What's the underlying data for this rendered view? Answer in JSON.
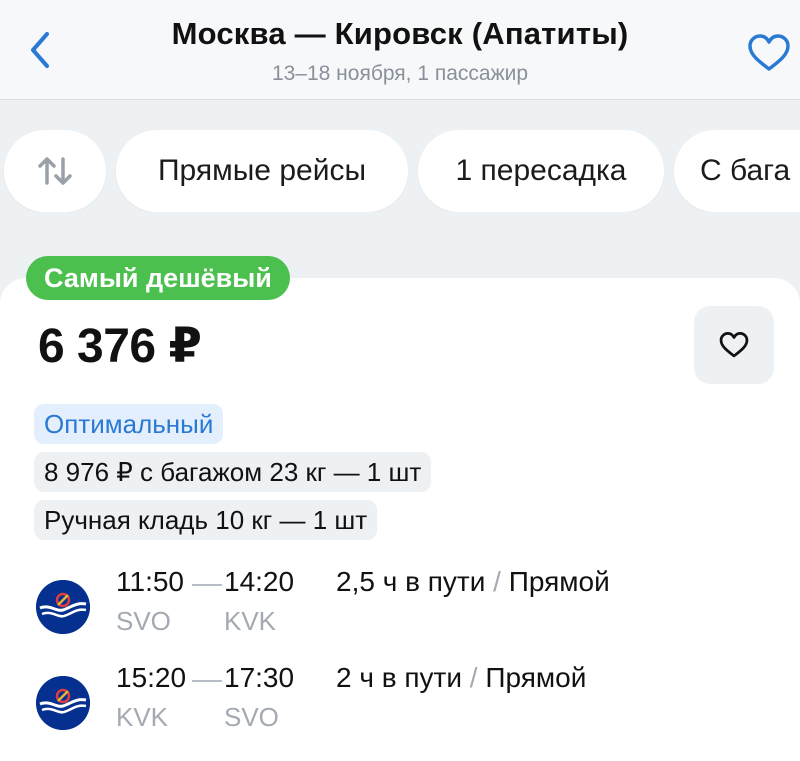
{
  "header": {
    "title": "Москва — Кировск (Апатиты)",
    "subtitle": "13–18 ноября, 1 пассажир",
    "back_icon": "chevron-left-icon",
    "favorite_icon": "heart-outline-icon",
    "accent_color": "#2a7ad4"
  },
  "filters": {
    "sort_icon": "sort-arrows-icon",
    "chips": [
      {
        "label": "Прямые рейсы"
      },
      {
        "label": "1 пересадка"
      },
      {
        "label": "С бага"
      }
    ]
  },
  "offer": {
    "badge": "Самый дешёвый",
    "badge_color": "#4cc04f",
    "price": "6 376 ₽",
    "favorite_icon": "heart-outline-icon",
    "tags": {
      "optimal": "Оптимальный",
      "baggage": "8 976 ₽ с багажом 23 кг — 1 шт",
      "hand_luggage": "Ручная кладь 10 кг — 1 шт"
    },
    "flights": [
      {
        "airline_icon": "aeroflot-logo-icon",
        "dep_time": "11:50",
        "arr_time": "14:20",
        "dep_code": "SVO",
        "arr_code": "KVK",
        "duration": "2,5 ч в пути",
        "separator": " / ",
        "type": "Прямой"
      },
      {
        "airline_icon": "aeroflot-logo-icon",
        "dep_time": "15:20",
        "arr_time": "17:30",
        "dep_code": "KVK",
        "arr_code": "SVO",
        "duration": "2 ч в пути",
        "separator": " / ",
        "type": "Прямой"
      }
    ]
  }
}
